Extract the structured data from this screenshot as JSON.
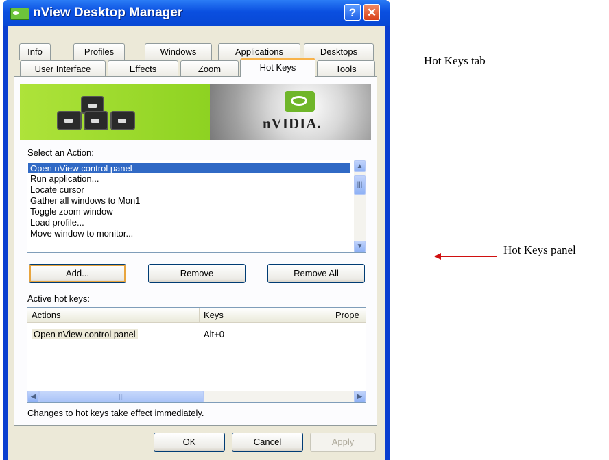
{
  "window": {
    "title": "nView Desktop Manager",
    "help_glyph": "?",
    "close_glyph": "✕"
  },
  "tabs_row1": [
    "Info",
    "Profiles",
    "Windows",
    "Applications",
    "Desktops"
  ],
  "tabs_row2": [
    "User Interface",
    "Effects",
    "Zoom",
    "Hot Keys",
    "Tools"
  ],
  "banner": {
    "brand": "nVIDIA."
  },
  "actions": {
    "label": "Select an Action:",
    "items": [
      "Open nView control panel",
      "Run application...",
      "Locate cursor",
      "Gather all windows to Mon1",
      "Toggle zoom window",
      "Load profile...",
      "Move window to monitor..."
    ],
    "selected": "Open nView control panel"
  },
  "buttons": {
    "add": "Add...",
    "remove": "Remove",
    "remove_all": "Remove All"
  },
  "hotkeys": {
    "label": "Active hot keys:",
    "columns": [
      "Actions",
      "Keys",
      "Prope"
    ],
    "rows": [
      {
        "action": "Open nView control panel",
        "keys": "Alt+0"
      }
    ]
  },
  "scroll_glyphs": {
    "up": "▲",
    "down": "▼",
    "left": "◀",
    "right": "▶",
    "grip": "|||"
  },
  "note": "Changes to hot keys take effect immediately.",
  "footer": {
    "ok": "OK",
    "cancel": "Cancel",
    "apply": "Apply"
  },
  "annotations": {
    "tab": "Hot Keys tab",
    "panel": "Hot Keys panel"
  },
  "colors": {
    "active_tab_highlight": "#f8b34a",
    "arrow": "#d01010",
    "titlebar": "#0a4fe0",
    "selection": "#316ac5"
  }
}
